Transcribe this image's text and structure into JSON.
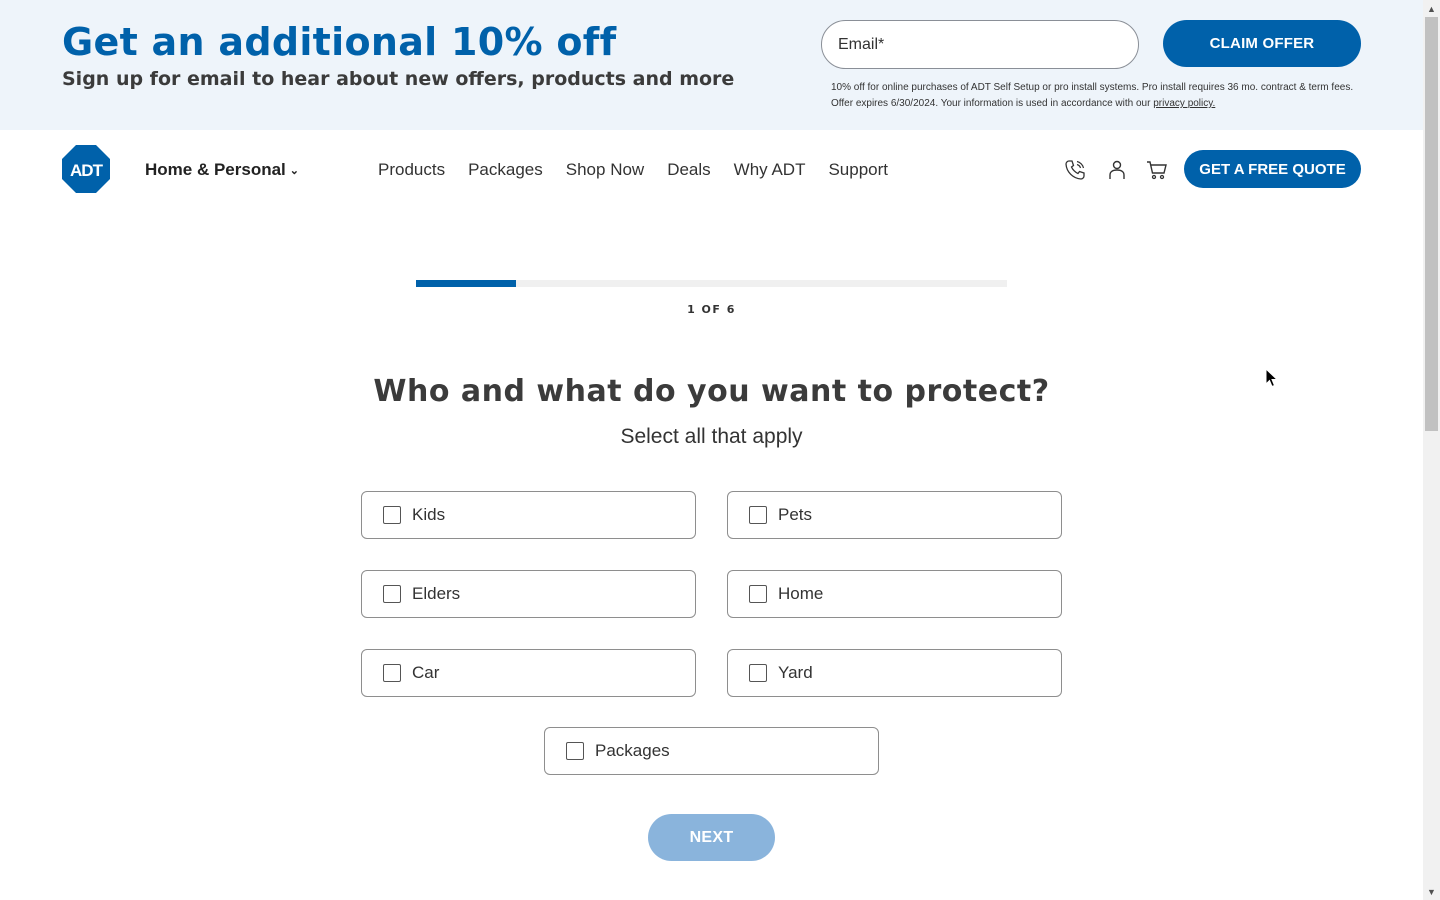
{
  "promo": {
    "title": "Get an additional 10% off",
    "subtitle": "Sign up for email to hear about new offers, products and more",
    "email_placeholder": "Email*",
    "claim_label": "CLAIM OFFER",
    "disclaimer_text": "10% off for online purchases of ADT Self Setup or pro install systems. Pro install requires 36 mo. contract & term fees. Offer expires 6/30/2024. Your information is used in accordance with our ",
    "privacy_link": "privacy policy."
  },
  "header": {
    "logo_text": "ADT",
    "audience_label": "Home & Personal",
    "nav": [
      "Products",
      "Packages",
      "Shop Now",
      "Deals",
      "Why ADT",
      "Support"
    ],
    "icons": [
      "phone-icon",
      "account-icon",
      "cart-icon"
    ],
    "quote_label": "GET A FREE QUOTE"
  },
  "quiz": {
    "progress": {
      "current": 1,
      "total": 6,
      "fraction": 0.17
    },
    "step_label": "1 OF 6",
    "question": "Who and what do you want to protect?",
    "instruction": "Select all that apply",
    "options": [
      {
        "label": "Kids",
        "checked": false
      },
      {
        "label": "Pets",
        "checked": false
      },
      {
        "label": "Elders",
        "checked": false
      },
      {
        "label": "Home",
        "checked": false
      },
      {
        "label": "Car",
        "checked": false
      },
      {
        "label": "Yard",
        "checked": false
      },
      {
        "label": "Packages",
        "checked": false
      }
    ],
    "next_label": "NEXT"
  },
  "colors": {
    "brand": "#0061aa",
    "promo_bg": "#eef4fa",
    "next_disabled": "#8ab4dc"
  }
}
